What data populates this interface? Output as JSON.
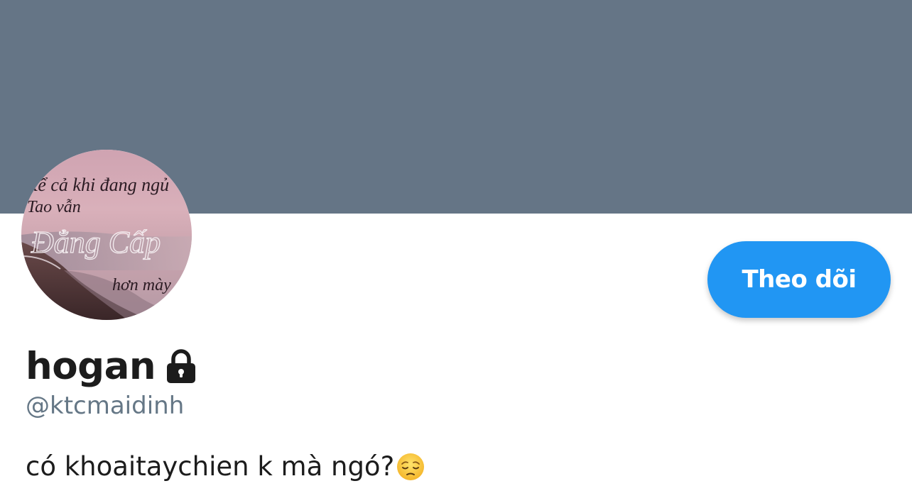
{
  "colors": {
    "banner": "#657586",
    "accent": "#2196f3",
    "handle": "#657786",
    "text": "#1c1c1c"
  },
  "avatar": {
    "line1": "Kể cả khi đang ngủ",
    "line2": "Tao vẫn",
    "line3": "Đẳng Cấp",
    "line4": "hơn mày"
  },
  "profile": {
    "display_name": "hogan",
    "handle": "@ktcmaidinh",
    "bio": "có khoaitaychien k mà ngó?",
    "protected_icon": "lock-icon",
    "bio_emoji": "pensive-face-icon"
  },
  "actions": {
    "follow_label": "Theo dõi"
  }
}
